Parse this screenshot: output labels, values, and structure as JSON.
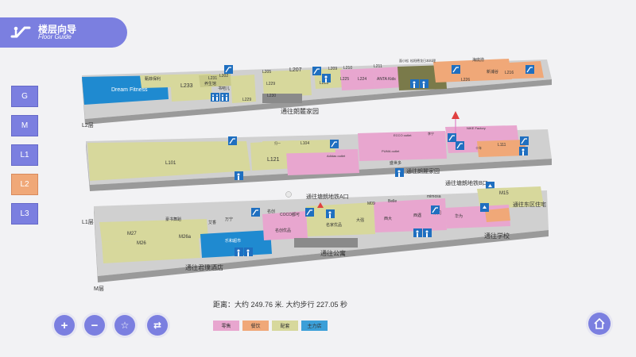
{
  "header": {
    "title": "楼层向导",
    "subtitle": "Floor Guide"
  },
  "floors": [
    {
      "label": "G",
      "active": false
    },
    {
      "label": "M",
      "active": false
    },
    {
      "label": "L1",
      "active": false
    },
    {
      "label": "L2",
      "active": true
    },
    {
      "label": "L3",
      "active": false
    }
  ],
  "map": {
    "level_labels": {
      "l2": "L2层",
      "l1": "L1层",
      "m": "M层"
    },
    "l2_labels": {
      "dream": "Dream Fitness",
      "zhentu": "甄菲保利",
      "l233": "L233",
      "l231": "L231",
      "yang": "养生馆",
      "l202": "L202",
      "shu": "书吧儿",
      "l229a": "L229",
      "l205": "L205",
      "l207": "L207",
      "l209": "L209",
      "l210": "L210",
      "l211": "L211",
      "l216": "L216",
      "l229b": "L229",
      "l228": "L228",
      "l225": "L225",
      "l224": "L224",
      "anta": "ANTA Kids",
      "l230": "L230",
      "dest": "通往朗麓家园",
      "haixin": "海底捞",
      "sun": "新浦谷",
      "l226": "L226",
      "small1": "面小松",
      "small2": "松阳德龙日本料理"
    },
    "l1_labels": {
      "l101": "L101",
      "l104": "L104",
      "l121": "L121",
      "adidas": "Adidas outlet",
      "puma": "PUMA outlet",
      "ecco": "ECCO outlet",
      "nike": "NIKE Factory",
      "l111": "L111",
      "dest": "通往朗麓家园",
      "dest_b": "通往塘朗地铁B口",
      "shengshi": "盛世多",
      "lining": "李宁",
      "guiyi": "归一",
      "shi": "十年"
    },
    "m_labels": {
      "dest_a": "通往塘朗地铁A口",
      "m09": "M09",
      "m27": "M27",
      "m26": "M26",
      "m26a": "M26a",
      "m15": "M15",
      "dest_hotel": "通往君璞酒店",
      "dest_apt": "通往公寓",
      "dest_east": "通往东区住宅",
      "dest_school": "通往学校",
      "supermarket": "乐和超市",
      "aixiang": "艾香",
      "wanning": "万宁",
      "mizhou": "名创优品",
      "coco": "COCO都可",
      "belle": "Belle",
      "mimosa": "mimosa",
      "xida": "西大",
      "huawei": "华为",
      "bianhuo": "名家优品",
      "daqiang": "大强",
      "xi": "西遇",
      "mingchuang": "名创",
      "dongmen": "东门",
      "haoshu": "豪书舞蹈"
    }
  },
  "distance": {
    "text": "距离：大约 249.76 米. 大约步行 227.05 秒"
  },
  "legend": [
    {
      "label": "零售",
      "color": "#e8a6cf"
    },
    {
      "label": "餐饮",
      "color": "#f0a878"
    },
    {
      "label": "配套",
      "color": "#d7d89c"
    },
    {
      "label": "主力店",
      "color": "#3b9fd8"
    }
  ],
  "colors": {
    "accent": "#7b7fe0",
    "active_floor": "#f0a878",
    "route": "#e04040"
  },
  "controls": [
    "zoom-in",
    "zoom-out",
    "favorite",
    "switch"
  ]
}
